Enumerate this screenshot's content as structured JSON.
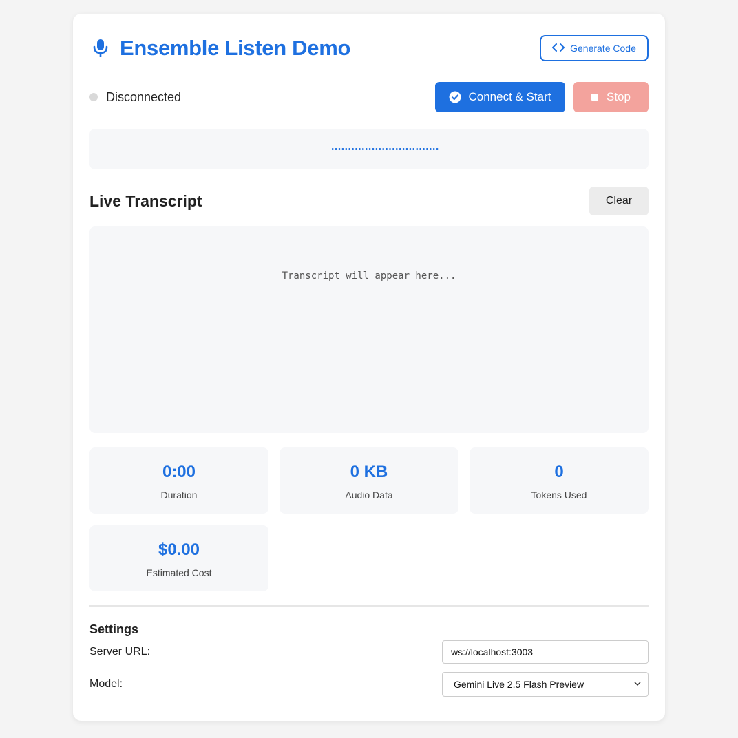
{
  "header": {
    "title": "Ensemble Listen Demo",
    "generate_code_label": "Generate Code"
  },
  "status": {
    "text": "Disconnected",
    "connect_label": "Connect & Start",
    "stop_label": "Stop"
  },
  "transcript": {
    "heading": "Live Transcript",
    "clear_label": "Clear",
    "placeholder": "Transcript will appear here..."
  },
  "stats": [
    {
      "value": "0:00",
      "label": "Duration"
    },
    {
      "value": "0 KB",
      "label": "Audio Data"
    },
    {
      "value": "0",
      "label": "Tokens Used"
    },
    {
      "value": "$0.00",
      "label": "Estimated Cost"
    }
  ],
  "settings": {
    "heading": "Settings",
    "server_url_label": "Server URL:",
    "server_url_value": "ws://localhost:3003",
    "model_label": "Model:",
    "model_value": "Gemini Live 2.5 Flash Preview"
  },
  "colors": {
    "accent": "#1e70e0",
    "stop_disabled": "#f3a39d",
    "panel_bg": "#f6f7f9"
  },
  "icons": {
    "title_icon": "microphone-icon",
    "generate_icon": "code-brackets-icon",
    "connect_icon": "check-circle-icon",
    "stop_icon": "stop-square-icon"
  }
}
